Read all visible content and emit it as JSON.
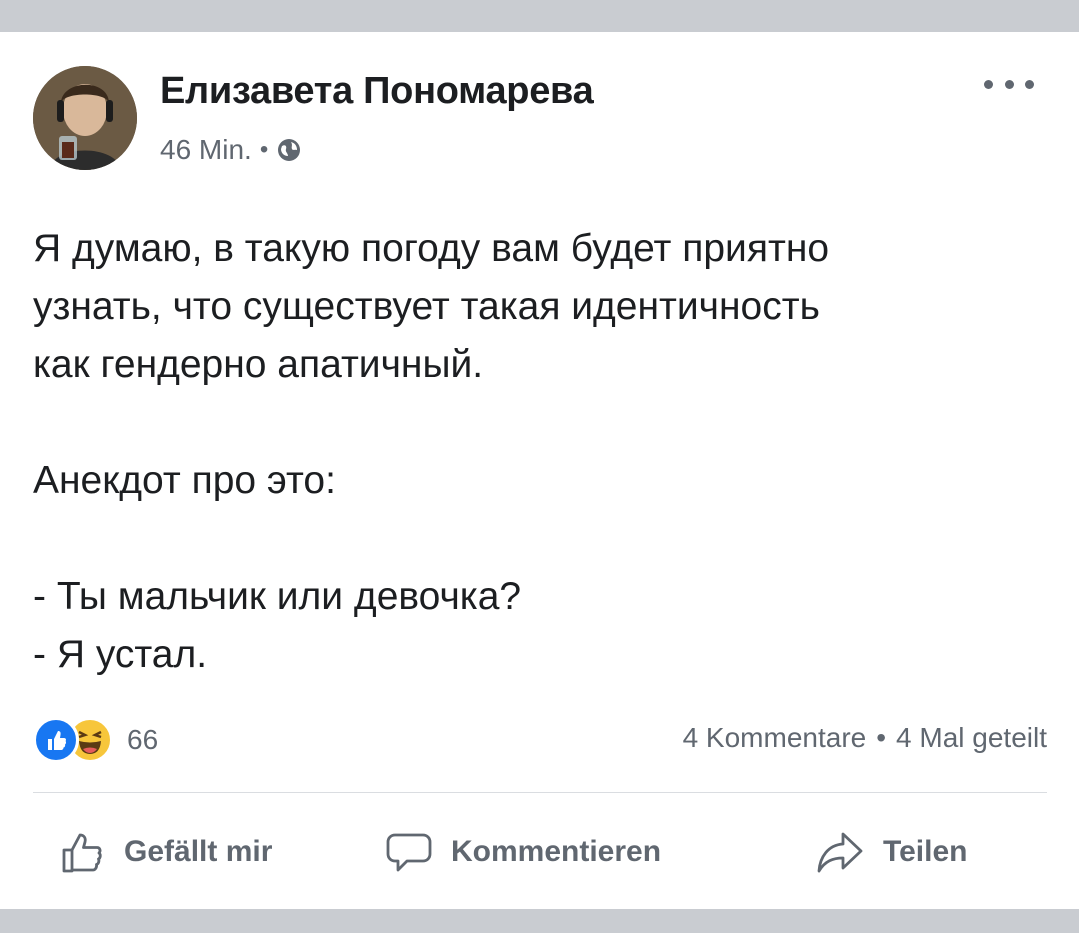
{
  "post": {
    "author": "Елизавета Пономарева",
    "time": "46 Min.",
    "separator": "•",
    "privacy_icon": "globe-icon",
    "menu_icon": "more-options-icon",
    "paragraphs": [
      "Я думаю, в такую погоду вам будет приятно\nузнать, что существует такая идентичность\nкак гендерно апатичный.",
      "Анекдот про это:",
      "- Ты мальчик или девочка?\n- Я устал."
    ]
  },
  "reactions": {
    "icons": [
      "like-reaction-icon",
      "haha-reaction-icon"
    ],
    "count": "66"
  },
  "stats": {
    "comments": "4 Kommentare",
    "separator": "•",
    "shares": "4 Mal geteilt"
  },
  "actions": {
    "like_label": "Gefällt mir",
    "comment_label": "Kommentieren",
    "share_label": "Teilen"
  },
  "colors": {
    "text": "#1c1e21",
    "secondary": "#606770",
    "like_blue": "#1877f2",
    "haha_yellow": "#f7c63b",
    "background": "#c9ccd1"
  }
}
